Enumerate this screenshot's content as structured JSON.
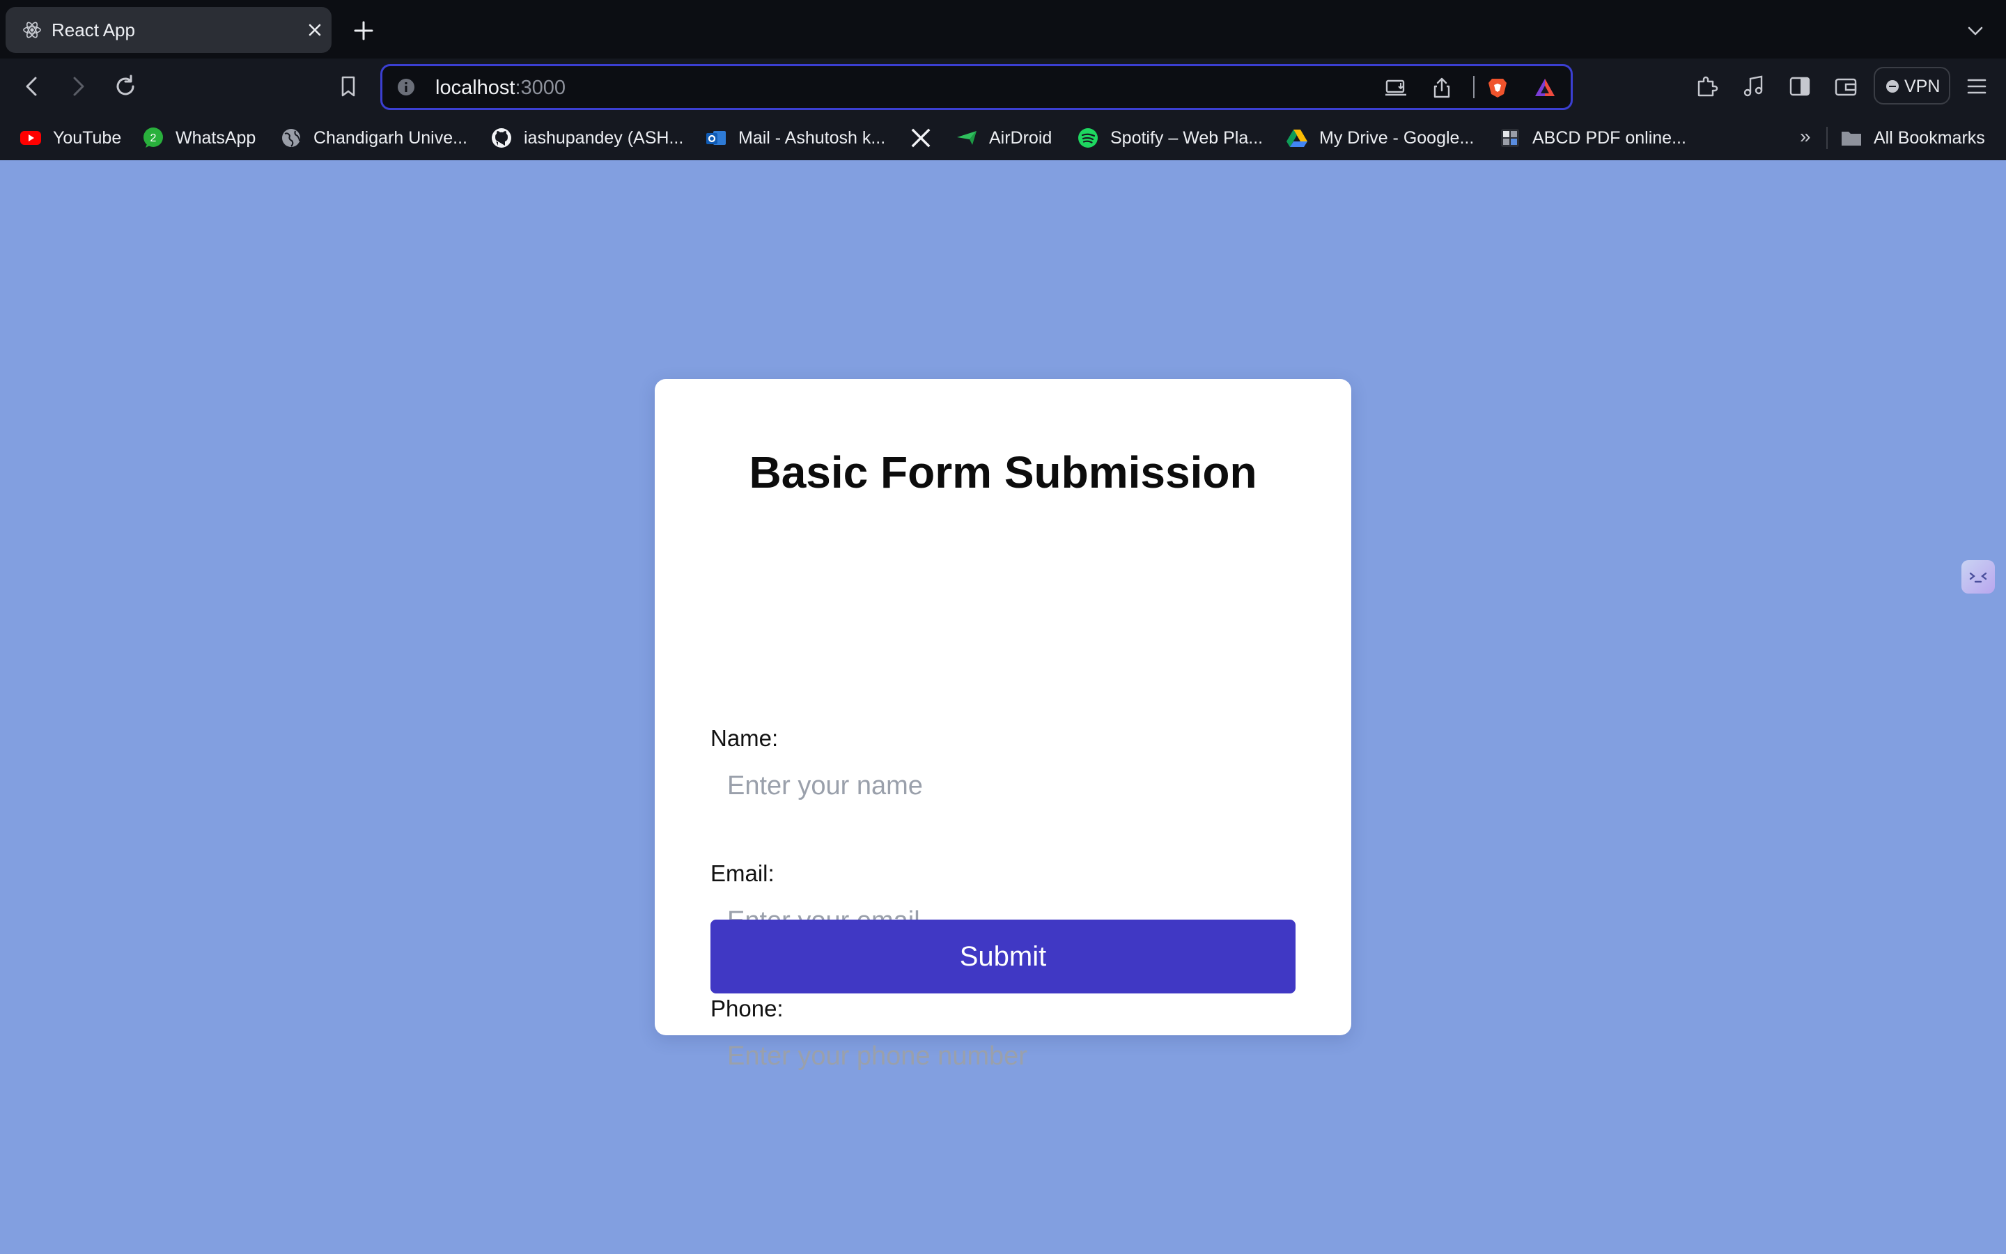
{
  "browser": {
    "tab": {
      "title": "React App",
      "favicon": "react-icon"
    },
    "address": {
      "host": "localhost",
      "port": ":3000"
    },
    "vpn_label": "VPN",
    "bookmarks": [
      {
        "label": "YouTube",
        "icon": "youtube-icon"
      },
      {
        "label": "WhatsApp",
        "icon": "whatsapp-icon",
        "badge": "2"
      },
      {
        "label": "Chandigarh Unive...",
        "icon": "globe-icon"
      },
      {
        "label": "iashupandey (ASH...",
        "icon": "github-icon"
      },
      {
        "label": "Mail - Ashutosh k...",
        "icon": "outlook-icon"
      },
      {
        "label": "",
        "icon": "x-twitter-icon"
      },
      {
        "label": "AirDroid",
        "icon": "airdroid-icon"
      },
      {
        "label": "Spotify – Web Pla...",
        "icon": "spotify-icon"
      },
      {
        "label": "My Drive - Google...",
        "icon": "google-drive-icon"
      },
      {
        "label": "ABCD PDF online...",
        "icon": "pdf-icon"
      }
    ],
    "more_bookmarks": "»",
    "all_bookmarks": "All Bookmarks"
  },
  "form": {
    "title": "Basic Form Submission",
    "name_label": "Name:",
    "name_placeholder": "Enter your name",
    "email_label": "Email:",
    "email_placeholder": "Enter your email",
    "phone_label": "Phone:",
    "phone_placeholder": "Enter your phone number",
    "submit_label": "Submit"
  },
  "colors": {
    "page_background": "#829fe0",
    "submit_button": "#4038c4",
    "card": "#ffffff",
    "chrome_dark": "#151820"
  }
}
